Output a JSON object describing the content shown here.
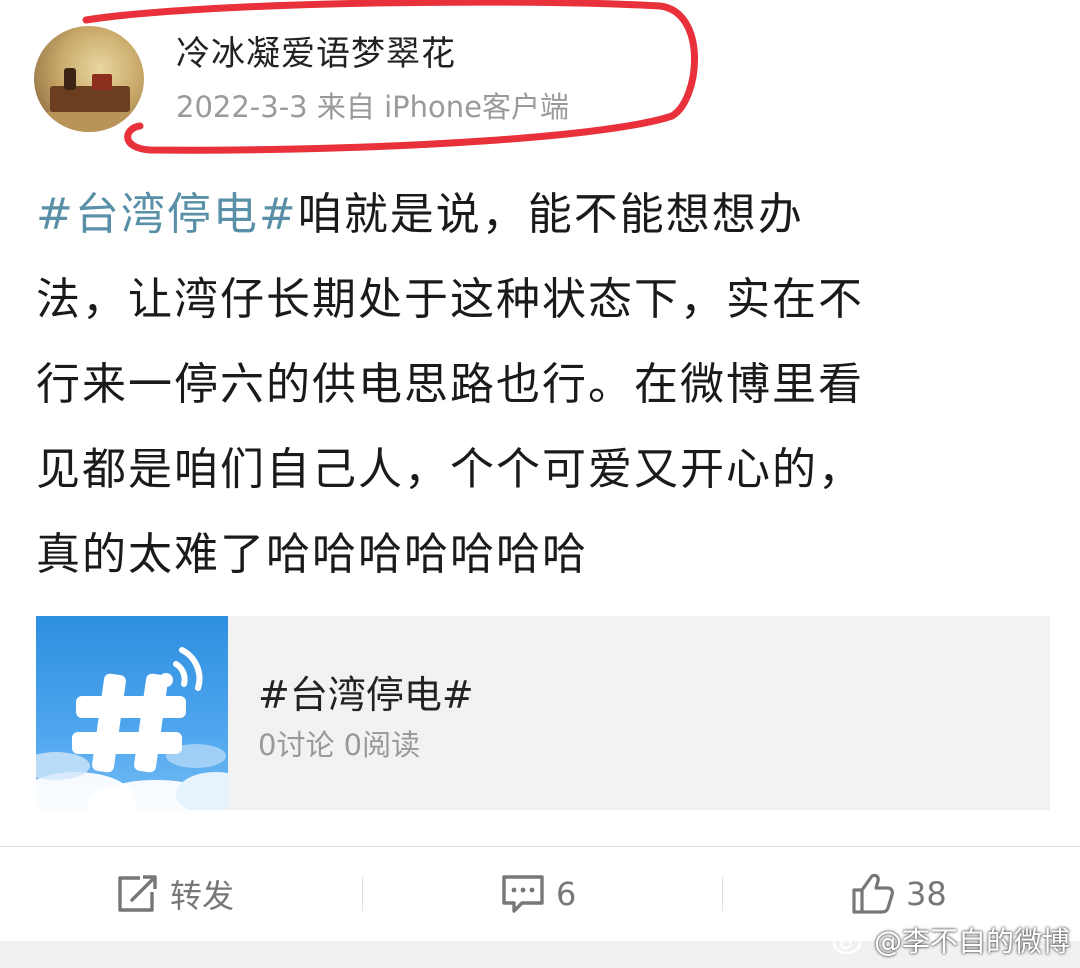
{
  "post": {
    "user_name": "冷冰凝爱语梦翠花",
    "meta": "2022-3-3 来自 iPhone客户端",
    "hashtag": "#台湾停电#",
    "text_lines": [
      "咱就是说，能不能想想办",
      "法，让湾仔长期处于这种状态下，实在不",
      "行来一停六的供电思路也行。在微博里看",
      "见都是咱们自己人，个个可爱又开心的，",
      "真的太难了哈哈哈哈哈哈哈"
    ]
  },
  "topic_card": {
    "title": "#台湾停电#",
    "stats": "0讨论 0阅读"
  },
  "actions": {
    "repost_label": "转发",
    "comment_count": "6",
    "like_count": "38"
  },
  "watermark": {
    "text": "@李不自的微博"
  },
  "colors": {
    "hashtag": "#5a8fa8",
    "highlight_oval": "#e8313a",
    "topic_image": "#3a98e6"
  },
  "icons": {
    "repost": "repost-icon",
    "comment": "comment-icon",
    "like": "thumbs-up-icon",
    "topic": "hashtag-signal-icon",
    "watermark": "weibo-logo-icon"
  }
}
